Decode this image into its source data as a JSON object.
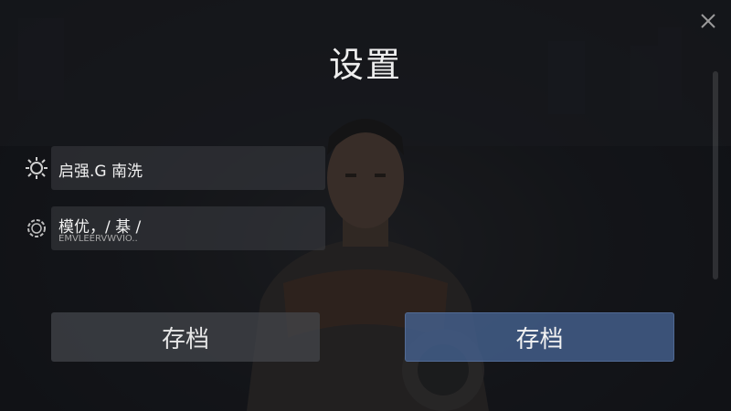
{
  "dialog": {
    "title": "设置"
  },
  "options": [
    {
      "label": "启强.G 南洗",
      "sublabel": "",
      "icon": "sun-icon"
    },
    {
      "label": "模优，/ 棊 /",
      "sublabel": "EMVLEERVWVIO..",
      "icon": "gear-icon"
    }
  ],
  "buttons": {
    "left_label": "存档",
    "right_label": "存档"
  },
  "colors": {
    "primary_button": "#44608e",
    "secondary_button": "#46484e",
    "overlay": "#0e1014"
  }
}
